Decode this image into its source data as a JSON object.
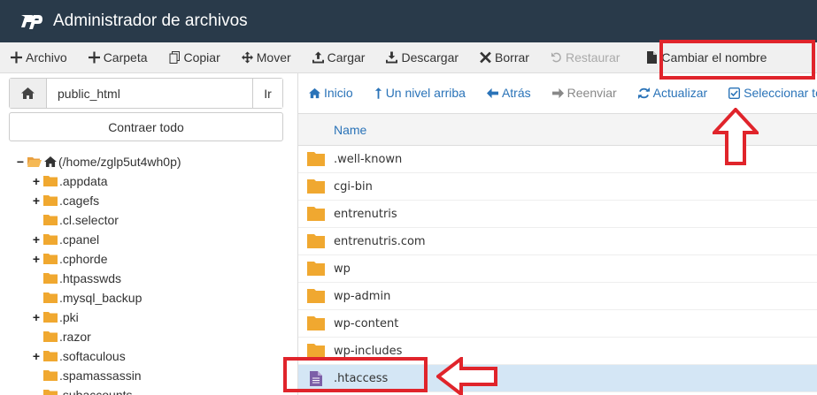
{
  "app": {
    "title": "Administrador de archivos",
    "logo_icon": "cpanel-logo-icon"
  },
  "toolbar": {
    "items": [
      {
        "label": "Archivo",
        "icon": "plus-icon"
      },
      {
        "label": "Carpeta",
        "icon": "plus-icon"
      },
      {
        "label": "Copiar",
        "icon": "copy-icon"
      },
      {
        "label": "Mover",
        "icon": "move-icon"
      },
      {
        "label": "Cargar",
        "icon": "upload-icon"
      },
      {
        "label": "Descargar",
        "icon": "download-icon"
      },
      {
        "label": "Borrar",
        "icon": "close-icon"
      },
      {
        "label": "Restaurar",
        "icon": "undo-icon",
        "disabled": true
      },
      {
        "label": "Cambiar el nombre",
        "icon": "file-icon"
      }
    ]
  },
  "sidebar": {
    "path_value": "public_html",
    "go_label": "Ir",
    "collapse_label": "Contraer todo",
    "root_label": "(/home/zglp5ut4wh0p)",
    "tree": [
      {
        "label": ".appdata",
        "expandable": true
      },
      {
        "label": ".cagefs",
        "expandable": true
      },
      {
        "label": ".cl.selector",
        "expandable": false
      },
      {
        "label": ".cpanel",
        "expandable": true
      },
      {
        "label": ".cphorde",
        "expandable": true
      },
      {
        "label": ".htpasswds",
        "expandable": false
      },
      {
        "label": ".mysql_backup",
        "expandable": false
      },
      {
        "label": ".pki",
        "expandable": true
      },
      {
        "label": ".razor",
        "expandable": false
      },
      {
        "label": ".softaculous",
        "expandable": true
      },
      {
        "label": ".spamassassin",
        "expandable": false
      },
      {
        "label": ".subaccounts",
        "expandable": false
      }
    ]
  },
  "nav": {
    "items": [
      {
        "label": "Inicio",
        "icon": "home-icon",
        "disabled": false
      },
      {
        "label": "Un nivel arriba",
        "icon": "level-up-icon",
        "disabled": false
      },
      {
        "label": "Atrás",
        "icon": "arrow-left-icon",
        "disabled": false
      },
      {
        "label": "Reenviar",
        "icon": "arrow-right-icon",
        "disabled": true
      },
      {
        "label": "Actualizar",
        "icon": "refresh-icon",
        "disabled": false
      },
      {
        "label": "Seleccionar todo",
        "icon": "checkbox-icon",
        "disabled": false
      }
    ]
  },
  "files": {
    "column_name": "Name",
    "rows": [
      {
        "name": ".well-known",
        "type": "folder"
      },
      {
        "name": "cgi-bin",
        "type": "folder"
      },
      {
        "name": "entrenutris",
        "type": "folder"
      },
      {
        "name": "entrenutris.com",
        "type": "folder"
      },
      {
        "name": "wp",
        "type": "folder"
      },
      {
        "name": "wp-admin",
        "type": "folder"
      },
      {
        "name": "wp-content",
        "type": "folder"
      },
      {
        "name": "wp-includes",
        "type": "folder"
      },
      {
        "name": ".htaccess",
        "type": "file",
        "selected": true
      }
    ]
  },
  "colors": {
    "titlebar": "#293a4a",
    "link": "#2a73b8",
    "folder": "#f0a830",
    "callout": "#e0242b",
    "selected_row": "#d4e6f5"
  }
}
